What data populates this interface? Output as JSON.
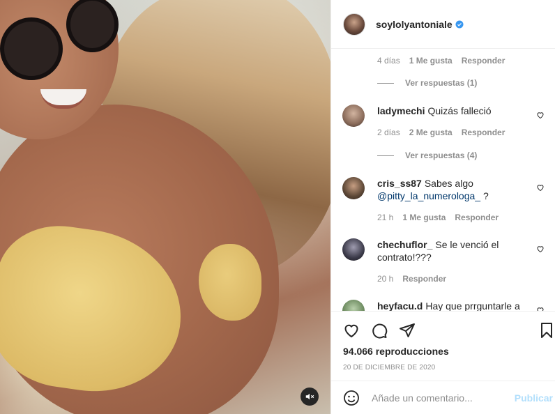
{
  "post": {
    "username": "soylolyantoniale",
    "verified": true,
    "views": "94.066 reproducciones",
    "date": "20 DE DICIEMBRE DE 2020"
  },
  "thread": {
    "top_meta": {
      "time": "4 días",
      "likes": "1 Me gusta",
      "reply": "Responder"
    },
    "top_replies": "Ver respuestas (1)"
  },
  "comments": [
    {
      "user": "ladymechi",
      "text": "Quizás falleció",
      "mention": "",
      "time": "2 días",
      "likes": "2 Me gusta",
      "reply": "Responder",
      "replies": "Ver respuestas (4)",
      "avatar_color": "#8a6b5a"
    },
    {
      "user": "cris_ss87",
      "text": "Sabes algo",
      "mention": "@pitty_la_numerologa_",
      "mention_suffix": " ?",
      "time": "21 h",
      "likes": "1 Me gusta",
      "reply": "Responder",
      "avatar_color": "#5c4736"
    },
    {
      "user": "chechuflor_",
      "text": "Se le venció el contrato!???",
      "time": "20 h",
      "reply": "Responder",
      "avatar_color": "#3c3b4a"
    },
    {
      "user": "heyfacu.d",
      "text": "Hay que prrguntarle a",
      "avatar_color": "#6c8a5f"
    }
  ],
  "add_comment": {
    "placeholder": "Añade un comentario...",
    "publish": "Publicar"
  },
  "colors": {
    "verified": "#3897f0",
    "link": "#00376b",
    "muted": "#8e8e8e",
    "publish_disabled": "#b2dffc"
  }
}
